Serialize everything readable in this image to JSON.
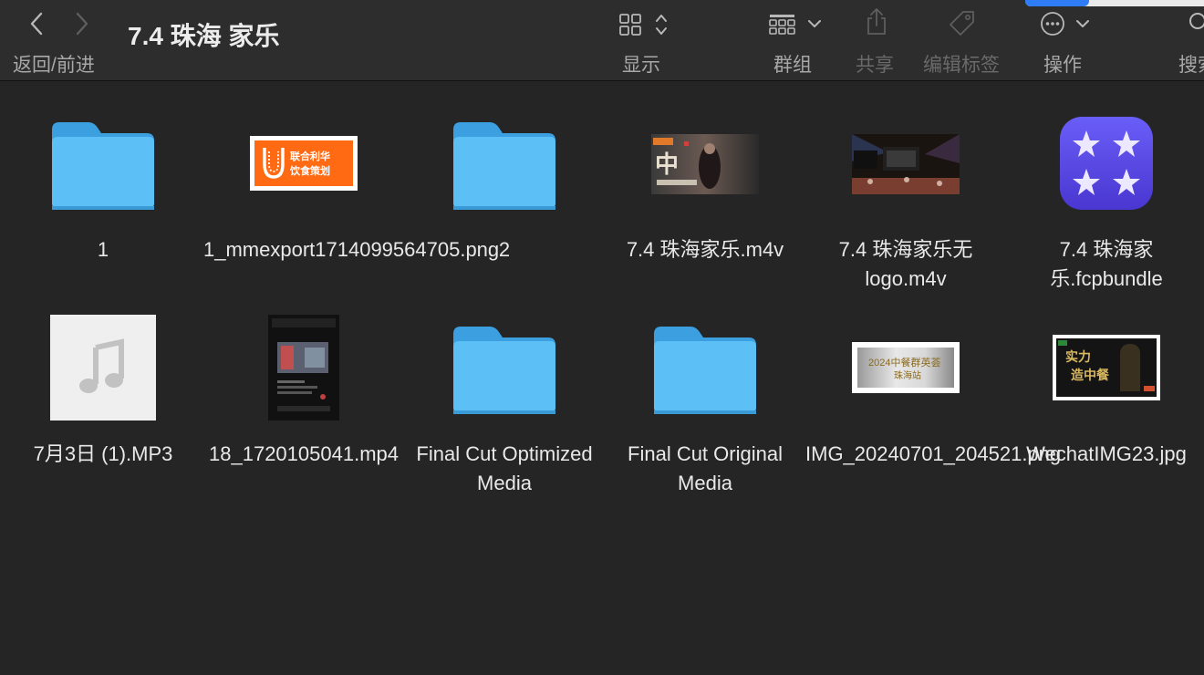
{
  "toolbar": {
    "title": "7.4 珠海 家乐",
    "nav_label": "返回/前进",
    "view_label": "显示",
    "group_label": "群组",
    "share_label": "共享",
    "tags_label": "编辑标签",
    "action_label": "操作",
    "search_label": "搜索"
  },
  "files": [
    {
      "name": "1",
      "kind": "folder"
    },
    {
      "name": "1_mmexport1714099564705.png",
      "kind": "image",
      "thumb_text_1": "联合利华",
      "thumb_text_2": "饮食策划"
    },
    {
      "name": "2",
      "kind": "folder"
    },
    {
      "name": "7.4 珠海家乐.m4v",
      "kind": "video"
    },
    {
      "name": "7.4 珠海家乐无logo.m4v",
      "kind": "video"
    },
    {
      "name": "7.4 珠海家乐.fcpbundle",
      "kind": "fcpbundle"
    },
    {
      "name": "7月3日 (1).MP3",
      "kind": "audio"
    },
    {
      "name": "18_1720105041.mp4",
      "kind": "video"
    },
    {
      "name": "Final Cut Optimized Media",
      "kind": "folder"
    },
    {
      "name": "Final Cut Original Media",
      "kind": "folder"
    },
    {
      "name": "IMG_20240701_204521.png",
      "kind": "image",
      "thumb_text_1": "2024中餐群英荟",
      "thumb_text_2": "珠海站"
    },
    {
      "name": "WechatIMG23.jpg",
      "kind": "image",
      "thumb_text_1": "实力",
      "thumb_text_2": "造中餐"
    }
  ]
}
